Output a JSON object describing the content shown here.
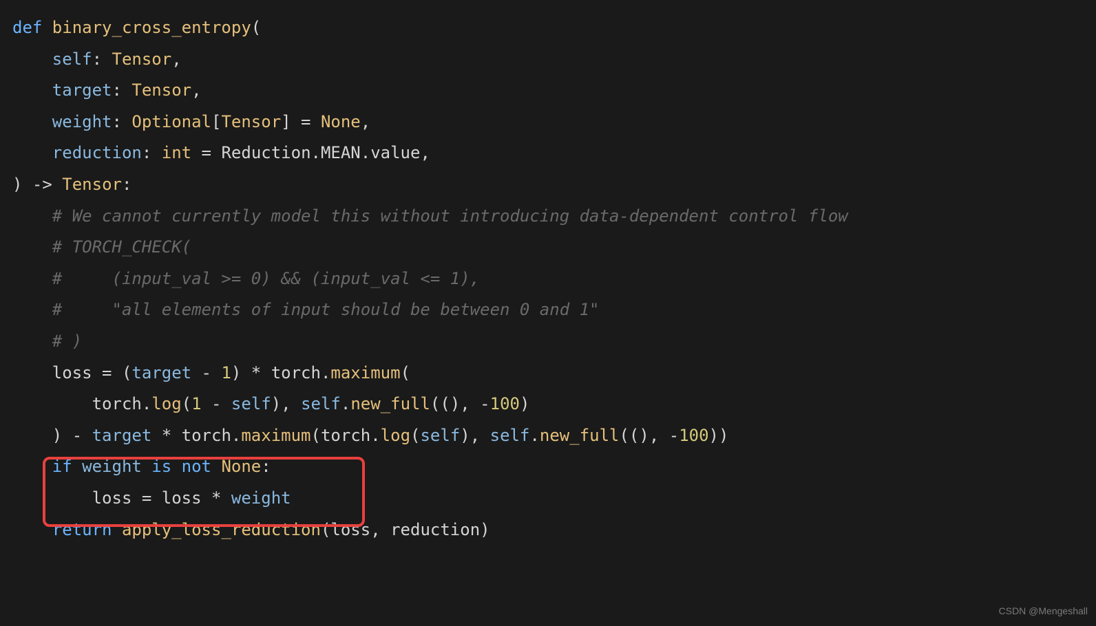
{
  "code": {
    "l1": {
      "def": "def ",
      "name": "binary_cross_entropy",
      "open": "("
    },
    "l2": {
      "indent": "    ",
      "p": "self",
      "colon": ": ",
      "t": "Tensor",
      "comma": ","
    },
    "l3": {
      "indent": "    ",
      "p": "target",
      "colon": ": ",
      "t": "Tensor",
      "comma": ","
    },
    "l4": {
      "indent": "    ",
      "p": "weight",
      "colon": ": ",
      "t": "Optional",
      "br1": "[",
      "t2": "Tensor",
      "br2": "] = ",
      "none": "None",
      "comma": ","
    },
    "l5": {
      "indent": "    ",
      "p": "reduction",
      "colon": ": ",
      "t": "int",
      "eq": " = ",
      "v": "Reduction.MEAN.value",
      "comma": ","
    },
    "l6": {
      "close": ") ",
      "arrow": "-> ",
      "t": "Tensor",
      "colon": ":"
    },
    "l7": {
      "indent": "    ",
      "c": "# We cannot currently model this without introducing data-dependent control flow"
    },
    "l8": {
      "indent": "    ",
      "c": "# TORCH_CHECK("
    },
    "l9": {
      "indent": "    ",
      "c": "#     (input_val >= 0) && (input_val <= 1),"
    },
    "l10": {
      "indent": "    ",
      "c": "#     \"all elements of input should be between 0 and 1\""
    },
    "l11": {
      "indent": "    ",
      "c": "# )"
    },
    "l12": {
      "indent": "    ",
      "v": "loss",
      "eq": " = (",
      "p1": "target",
      "minus": " - ",
      "one": "1",
      "close1": ") * ",
      "torch": "torch",
      "dot": ".",
      "fn": "maximum",
      "open": "("
    },
    "l13": {
      "indent": "        ",
      "torch1": "torch",
      "dot1": ".",
      "fn1": "log",
      "open1": "(",
      "one": "1",
      "minus": " - ",
      "self1": "self",
      "close1": "), ",
      "self2": "self",
      "dot2": ".",
      "fn2": "new_full",
      "open2": "((), ",
      "neg": "-",
      "hundred": "100",
      "close2": ")"
    },
    "l14": {
      "indent": "    ",
      "close": ") - ",
      "target": "target",
      "mult": " * ",
      "torch": "torch",
      "dot": ".",
      "fn": "maximum",
      "open": "(",
      "torch2": "torch",
      "dot2": ".",
      "fn2": "log",
      "open2": "(",
      "self": "self",
      "close2": "), ",
      "self2": "self",
      "dot3": ".",
      "fn3": "new_full",
      "open3": "((), ",
      "neg": "-",
      "hundred": "100",
      "close3": "))"
    },
    "l15": {
      "indent": "    ",
      "if": "if ",
      "weight": "weight",
      "isnot": " is not ",
      "none": "None",
      "colon": ":"
    },
    "l16": {
      "indent": "        ",
      "loss": "loss",
      "eq": " = ",
      "loss2": "loss",
      "mult": " * ",
      "weight": "weight"
    },
    "l17": {
      "indent": "    ",
      "return": "return ",
      "fn": "apply_loss_reduction",
      "open": "(",
      "loss": "loss",
      "comma": ", ",
      "red": "reduction",
      "close": ")"
    }
  },
  "watermark": "CSDN @Mengeshall"
}
